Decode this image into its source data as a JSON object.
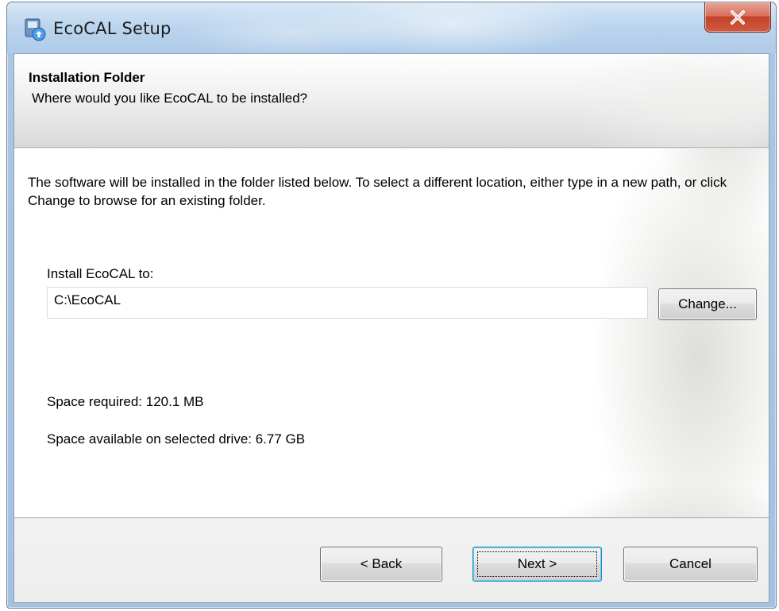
{
  "window": {
    "title": "EcoCAL Setup",
    "close_glyph": "X"
  },
  "header": {
    "title": "Installation Folder",
    "subtitle": "Where would you like EcoCAL to be installed?"
  },
  "body": {
    "description": "The software will be installed in the folder listed below. To select a different location, either type in a new path, or click Change to browse for an existing folder.",
    "install_label": "Install EcoCAL to:",
    "install_path": "C:\\EcoCAL",
    "change_button": "Change...",
    "space_required": "Space required: 120.1 MB",
    "space_available": "Space available on selected drive: 6.77 GB"
  },
  "footer": {
    "back_button": "< Back",
    "next_button": "Next >",
    "cancel_button": "Cancel"
  },
  "colors": {
    "titlebar": "#bcd5ee",
    "close_button": "#c4412a",
    "default_button_border": "#3c7fb1"
  },
  "icons": {
    "app": "installer-icon",
    "close": "close-icon"
  }
}
